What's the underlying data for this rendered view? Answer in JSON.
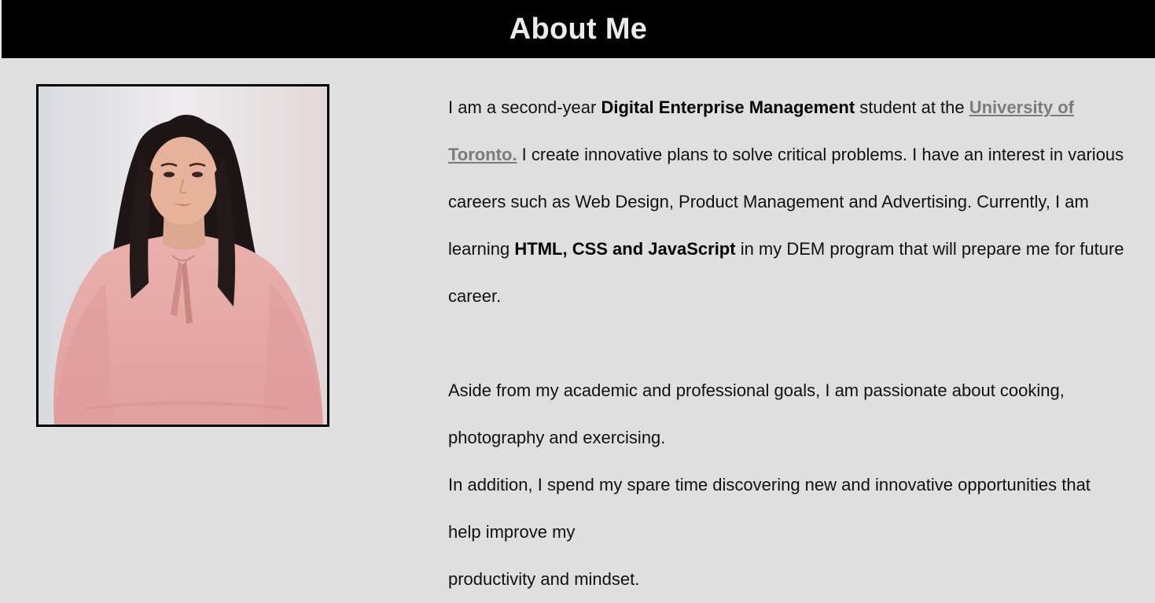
{
  "header": {
    "title": "About Me"
  },
  "profile_photo": {
    "icon": "portrait-photo",
    "colors": {
      "background": "#e9e7ea",
      "blouse": "#e8aaa8",
      "hair": "#1e1616",
      "skin": "#e6b29c"
    }
  },
  "bio": {
    "p1": {
      "t1": "I am a second-year ",
      "b1": "Digital Enterprise Management",
      "t2": " student at the ",
      "link": "University of Toronto.",
      "t3": " I create innovative plans to solve critical problems. I have an interest in various careers such as Web Design, Product Management and Advertising. Currently, I am learning ",
      "b2": "HTML, CSS and JavaScript",
      "t4": " in my DEM program that will prepare me for future career."
    },
    "p2": "Aside from my academic and professional goals, I am passionate about cooking, photography and exercising.",
    "p3": "In addition, I spend my spare time discovering new and innovative opportunities that help improve my",
    "p4": "productivity and mindset."
  },
  "colors": {
    "page_background": "#dfdfdf",
    "header_background": "#000000",
    "header_text": "#ececec",
    "link": "#7b7b7b"
  }
}
